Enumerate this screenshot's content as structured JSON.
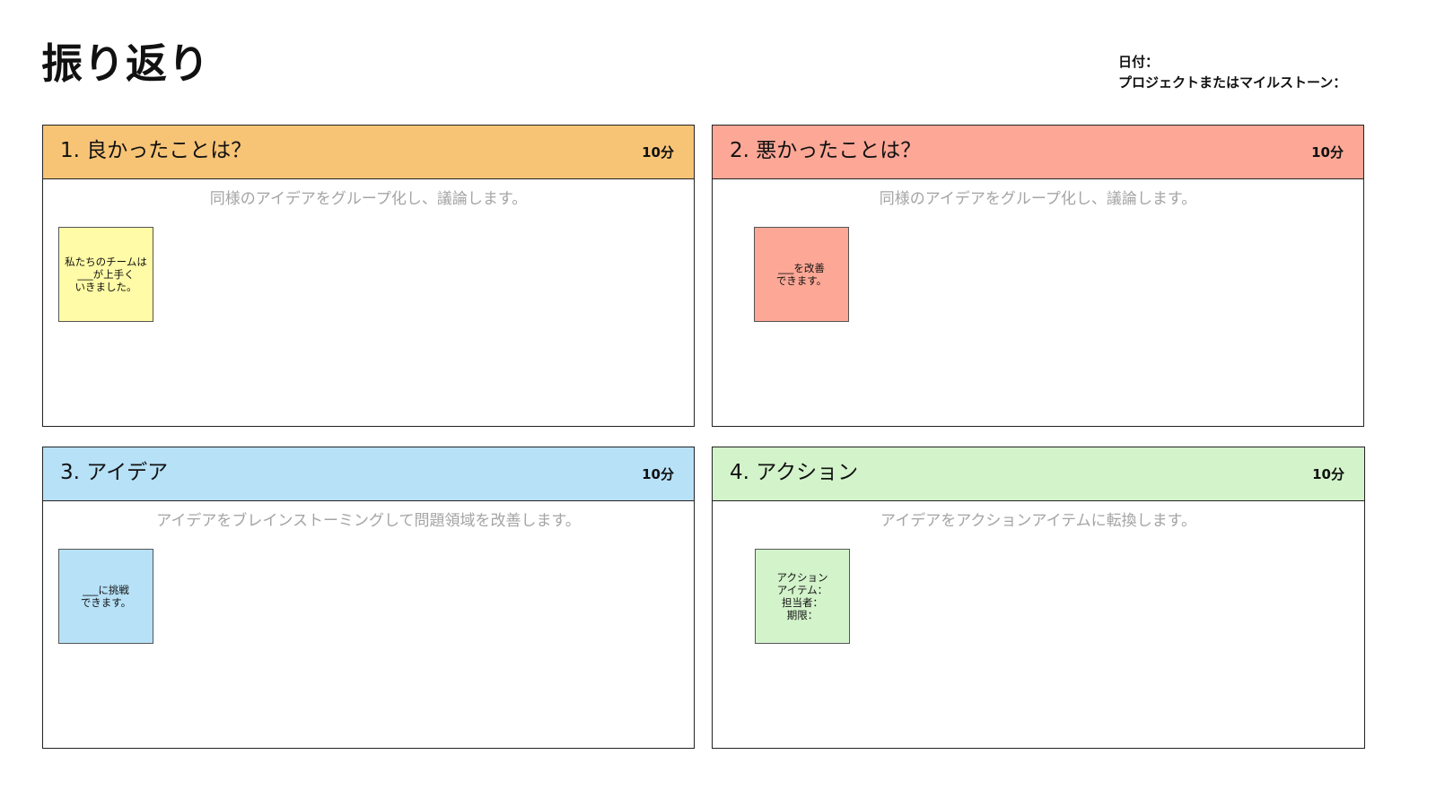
{
  "page": {
    "title": "振り返り"
  },
  "meta": {
    "date_label": "日付：",
    "project_label": "プロジェクトまたはマイルストーン："
  },
  "colors": {
    "orange": "#f7c476",
    "salmon": "#fda796",
    "blue": "#b7e1f7",
    "green": "#d3f3cb",
    "sticky_yellow": "#fffba6",
    "sticky_salmon": "#fda796",
    "sticky_blue": "#b7e1f7",
    "sticky_green": "#d3f3cb"
  },
  "panels": [
    {
      "title": "1. 良かったことは？",
      "time": "10分",
      "description": "同様のアイデアをグループ化し、議論します。",
      "sticky": "私たちのチームは\n___が上手く\nいきました。"
    },
    {
      "title": "2. 悪かったことは？",
      "time": "10分",
      "description": "同様のアイデアをグループ化し、議論します。",
      "sticky": "___を改善\nできます。"
    },
    {
      "title": "3. アイデア",
      "time": "10分",
      "description": "アイデアをブレインストーミングして問題領域を改善します。",
      "sticky": "___に挑戦\nできます。"
    },
    {
      "title": "4. アクション",
      "time": "10分",
      "description": "アイデアをアクションアイテムに転換します。",
      "sticky": "アクション\nアイテム：\n担当者：\n期限："
    }
  ]
}
